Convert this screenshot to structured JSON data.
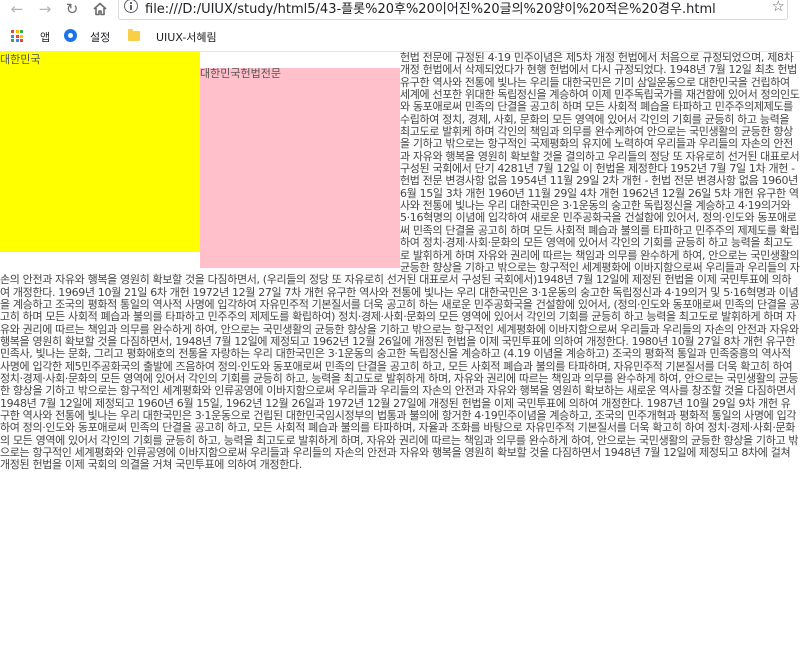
{
  "browser": {
    "url": "file:///D:/UIUX/study/html5/43-플롯%20후%20이어진%20글의%20양이%20적은%20경우.html",
    "bookmarks": {
      "apps": "앱",
      "settings": "설정",
      "folder": "UIUX-서혜림"
    },
    "icons": [
      "back-arrow-icon",
      "forward-arrow-icon",
      "reload-icon",
      "home-icon",
      "info-icon",
      "star-icon",
      "apps-grid-icon",
      "gear-icon",
      "folder-icon"
    ]
  },
  "boxes": {
    "yellow_label": "대한민국",
    "pink_label": "대한민국헌법전문",
    "yellow_color": "#ffff00",
    "pink_color": "#ffc0cb"
  },
  "content": {
    "text": "헌법 전문에 규정된 4·19 민주이념은 제5차 개정 헌법에서 처음으로 규정되었으며, 제8차 개정 헌법에서 삭제되었다가 현행 헌법에서 다시 규정되었다. 1948년 7월 12일 최초 헌법 유구한 역사와 전통에 빛나는 우리들 대한국민은 기미 삼일운동으로 대한민국을 건립하여 세계에 선포한 위대한 독립정신을 계승하여 이제 민주독립국가를 재건함에 있어서 정의인도와 동포애로써 민족의 단결을 공고히 하며 모든 사회적 폐습을 타파하고 민주주의제제도를 수립하여 정치, 경제, 사회, 문화의 모든 영역에 있어서 각인의 기회를 균등히 하고 능력을 최고도로 발휘케 하며 각인의 책임과 의무를 완수케하여 안으로는 국민생활의 균등한 향상을 기하고 밖으로는 항구적인 국제평화의 유지에 노력하여 우리들과 우리들의 자손의 안전과 자유와 행복을 영원히 확보할 것을 결의하고 우리들의 정당 또 자유로히 선거된 대표로서 구성된 국회에서 단기 4281년 7월 12일 이 헌법을 제정한다 1952년 7월 7일 1차 개헌 - 헌법 전문 변경사항 없음 1954년 11월 29일 2차 개헌 - 헌법 전문 변경사항 없음 1960년 6월 15일 3차 개헌 1960년 11월 29일 4차 개헌 1962년 12월 26일 5차 개헌 유구한 역사와 전통에 빛나는 우리 대한국민은 3·1운동의 숭고한 독립정신을 계승하고 4·19의거와 5·16혁명의 이념에 입각하여 새로운 민주공화국을 건설함에 있어서, 정의·인도와 동포애로써 민족의 단결을 공고히 하며 모든 사회적 폐습과 불의를 타파하고 민주주의 제제도를 확립하여 정치·경제·사회·문화의 모든 영역에 있어서 각인의 기회를 균등히 하고 능력을 최고도로 발휘하게 하며 자유와 권리에 따르는 책임과 의무를 완수하게 하여, 안으로는 국민생활의 균등한 향상을 기하고 밖으로는 항구적인 세계평화에 이바지함으로써 우리들과 우리들의 자손의 안전과 자유와 행복을 영원히 확보할 것을 다짐하면서, (우리들의 정당 또 자유로히 선거된 대표로서 구성된 국회에서)1948년 7월 12일에 제정된 헌법을 이제 국민투표에 의하여 개정한다. 1969년 10월 21일 6차 개헌 1972년 12월 27일 7차 개헌 유구한 역사와 전통에 빛나는 우리 대한국민은 3·1운동의 숭고한 독립정신과 4·19의거 및 5·16혁명과 이념을 계승하고 조국의 평화적 통일의 역사적 사명에 입각하여 자유민주적 기본질서를 더욱 공고히 하는 새로운 민주공화국을 건설함에 있어서, (정의·인도와 동포애로써 민족의 단결을 공고히 하며 모든 사회적 폐습과 불의를 타파하고 민주주의 제제도를 확립하여) 정치·경제·사회·문화의 모든 영역에 있어서 각인의 기회를 균등히 하고 능력을 최고도로 발휘하게 하며 자유와 권리에 따르는 책임과 의무를 완수하게 하여, 안으로는 국민생활의 균등한 향상을 기하고 밖으로는 항구적인 세계평화에 이바지함으로써 우리들과 우리들의 자손의 안전과 자유와 행복을 영원히 확보할 것을 다짐하면서, 1948년 7월 12일에 제정되고 1962년 12월 26일에 개정된 헌법을 이제 국민투표에 의하여 개정한다. 1980년 10월 27일 8차 개헌 유구한 민족사, 빛나는 문화, 그리고 평화애호의 전통을 자랑하는 우리 대한국민은 3·1운동의 숭고한 독립정신을 계승하고 (4.19 이념을 계승하고) 조국의 평화적 통일과 민족중흥의 역사적 사명에 입각한 제5민주공화국의 출발에 즈음하여 정의·인도와 동포애로써 민족의 단결을 공고히 하고, 모든 사회적 폐습과 불의를 타파하며, 자유민주적 기본질서를 더욱 확고히 하여 정치·경제·사회·문화의 모든 영역에 있어서 각인의 기회를 균등히 하고, 능력을 최고도로 발휘하게 하며, 자유와 권리에 따르는 책임과 의무를 완수하게 하여, 안으로는 국민생활의 균등한 향상을 기하고 밖으로는 항구적인 세계평화와 인류공영에 이바지함으로써 우리들과 우리들의 자손의 안전과 자유와 행복을 영원히 확보하는 새로운 역사를 창조할 것을 다짐하면서 1948년 7월 12일에 제정되고 1960년 6월 15일, 1962년 12월 26일과 1972년 12월 27일에 개정된 헌법을 이제 국민투표에 의하여 개정한다. 1987년 10월 29일 9차 개헌 유구한 역사와 전통에 빛나는 우리 대한국민은 3·1운동으로 건립된 대한민국임시정부의 법통과 불의에 항거한 4·19민주이념을 계승하고, 조국의 민주개혁과 평화적 통일의 사명에 입각하여 정의·인도와 동포애로써 민족의 단결을 공고히 하고, 모든 사회적 폐습과 불의를 타파하며, 자율과 조화를 바탕으로 자유민주적 기본질서를 더욱 확고히 하여 정치·경제·사회·문화의 모든 영역에 있어서 각인의 기회를 균등히 하고, 능력을 최고도로 발휘하게 하며, 자유와 권리에 따르는 책임과 의무를 완수하게 하여, 안으로는 국민생활의 균등한 향상을 기하고 밖으로는 항구적인 세계평화와 인류공영에 이바지함으로써 우리들과 우리들의 자손의 안전과 자유와 행복을 영원히 확보할 것을 다짐하면서 1948년 7월 12일에 제정되고 8차에 걸쳐 개정된 헌법을 이제 국회의 의결을 거쳐 국민투표에 의하여 개정한다."
  }
}
